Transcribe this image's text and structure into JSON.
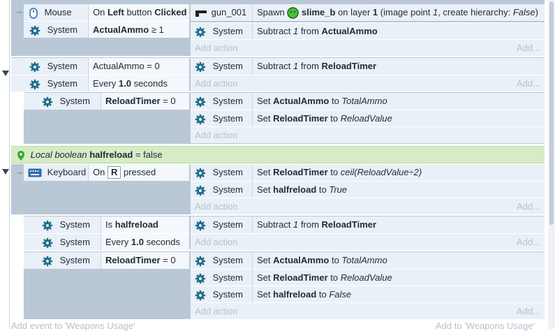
{
  "events": {
    "e1": {
      "cond1": {
        "object": "Mouse",
        "text_prefix": "On",
        "button": "Left",
        "mid": "button",
        "state": "Clicked"
      },
      "cond2": {
        "object": "System",
        "variable": "ActualAmmo",
        "op": "≥ 1"
      },
      "act1": {
        "object": "gun_001",
        "verb": "Spawn",
        "target": "slime_b",
        "on_layer": "on layer",
        "layer": "1",
        "rest": "(image point",
        "image_point": "1",
        "create": ", create hierarchy:",
        "hierarchy": "False",
        "close": ")"
      },
      "act2": {
        "object": "System",
        "verb": "Subtract",
        "amount": "1",
        "from": "from",
        "variable": "ActualAmmo"
      },
      "add_action": "Add action",
      "add_right": "Add..."
    },
    "e2": {
      "cond1": {
        "object": "System",
        "text": "ActualAmmo = 0"
      },
      "cond2": {
        "object": "System",
        "prefix": "Every",
        "value": "1.0",
        "unit": "seconds"
      },
      "act1": {
        "object": "System",
        "verb": "Subtract",
        "amount": "1",
        "from": "from",
        "variable": "ReloadTimer"
      },
      "add_action": "Add action",
      "add_right": "Add...",
      "sub": {
        "cond1": {
          "object": "System",
          "variable": "ReloadTimer",
          "op": "= 0"
        },
        "act1": {
          "object": "System",
          "verb": "Set",
          "variable": "ActualAmmo",
          "to": "to",
          "value": "TotalAmmo"
        },
        "act2": {
          "object": "System",
          "verb": "Set",
          "variable": "ReloadTimer",
          "to": "to",
          "value": "ReloadValue"
        },
        "add_action": "Add action"
      }
    },
    "local": {
      "label": "Local boolean",
      "name": "halfreload",
      "value": "= false"
    },
    "e3": {
      "cond1": {
        "object": "Keyboard",
        "prefix": "On",
        "key": "R",
        "suffix": "pressed"
      },
      "act1": {
        "object": "System",
        "verb": "Set",
        "variable": "ReloadTimer",
        "to": "to",
        "value": "ceil(ReloadValue÷2)"
      },
      "act2": {
        "object": "System",
        "verb": "Set",
        "variable": "halfreload",
        "to": "to",
        "value": "True"
      },
      "add_action": "Add action",
      "add_right": "Add...",
      "sub1": {
        "cond1": {
          "object": "System",
          "prefix": "Is",
          "variable": "halfreload"
        },
        "cond2": {
          "object": "System",
          "prefix": "Every",
          "value": "1.0",
          "unit": "seconds"
        },
        "act1": {
          "object": "System",
          "verb": "Subtract",
          "amount": "1",
          "from": "from",
          "variable": "ReloadTimer"
        },
        "add_action": "Add action",
        "add_right": "Add..."
      },
      "sub2": {
        "cond1": {
          "object": "System",
          "variable": "ReloadTimer",
          "op": "= 0"
        },
        "act1": {
          "object": "System",
          "verb": "Set",
          "variable": "ActualAmmo",
          "to": "to",
          "value": "TotalAmmo"
        },
        "act2": {
          "object": "System",
          "verb": "Set",
          "variable": "ReloadTimer",
          "to": "to",
          "value": "ReloadValue"
        },
        "act3": {
          "object": "System",
          "verb": "Set",
          "variable": "halfreload",
          "to": "to",
          "value": "False"
        },
        "add_action": "Add action",
        "add_right": "Add..."
      }
    }
  },
  "footer": {
    "add_event": "Add event to 'Weapons Usage'",
    "add_to": "Add to 'Weapons Usage'"
  },
  "colors": {
    "accent_green": "#28a745",
    "local_bg": "#d6ecc4",
    "group_fill": "#b9c7d6"
  },
  "icons": {
    "gear": "gear-icon",
    "mouse": "mouse-icon",
    "keyboard": "keyboard-icon",
    "gun": "gun-icon",
    "slime": "slime-icon",
    "pin": "location-pin-icon"
  }
}
